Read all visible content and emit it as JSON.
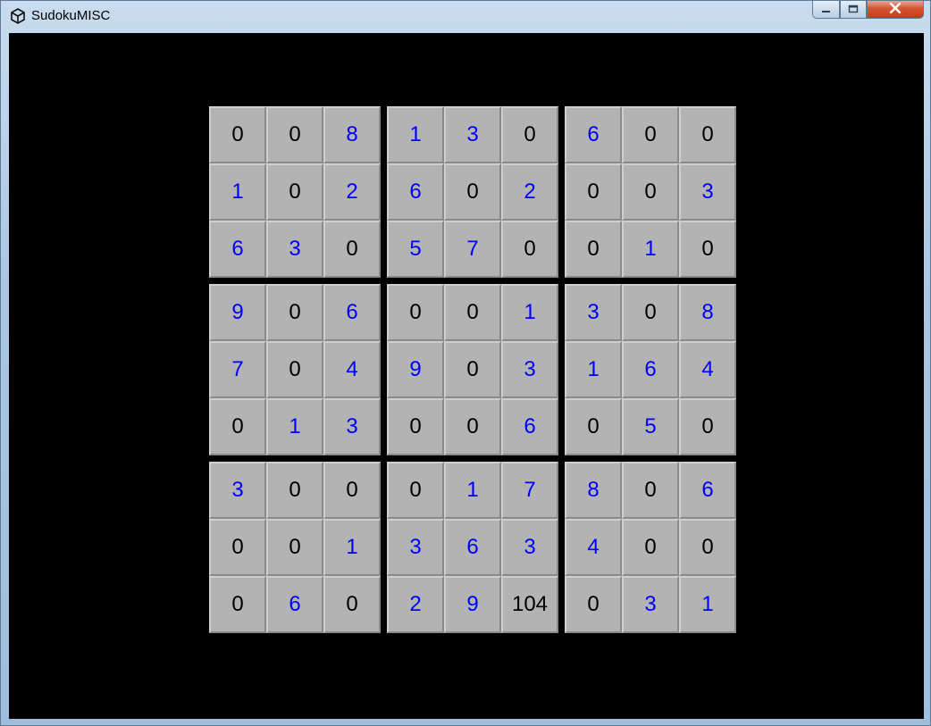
{
  "window": {
    "title": "SudokuMISC"
  },
  "colors": {
    "given": "#0000ff",
    "editable": "#000000"
  },
  "board": {
    "rows": [
      [
        {
          "v": "0",
          "given": false
        },
        {
          "v": "0",
          "given": false
        },
        {
          "v": "8",
          "given": true
        },
        {
          "v": "1",
          "given": true
        },
        {
          "v": "3",
          "given": true
        },
        {
          "v": "0",
          "given": false
        },
        {
          "v": "6",
          "given": true
        },
        {
          "v": "0",
          "given": false
        },
        {
          "v": "0",
          "given": false
        }
      ],
      [
        {
          "v": "1",
          "given": true
        },
        {
          "v": "0",
          "given": false
        },
        {
          "v": "2",
          "given": true
        },
        {
          "v": "6",
          "given": true
        },
        {
          "v": "0",
          "given": false
        },
        {
          "v": "2",
          "given": true
        },
        {
          "v": "0",
          "given": false
        },
        {
          "v": "0",
          "given": false
        },
        {
          "v": "3",
          "given": true
        }
      ],
      [
        {
          "v": "6",
          "given": true
        },
        {
          "v": "3",
          "given": true
        },
        {
          "v": "0",
          "given": false
        },
        {
          "v": "5",
          "given": true
        },
        {
          "v": "7",
          "given": true
        },
        {
          "v": "0",
          "given": false
        },
        {
          "v": "0",
          "given": false
        },
        {
          "v": "1",
          "given": true
        },
        {
          "v": "0",
          "given": false
        }
      ],
      [
        {
          "v": "9",
          "given": true
        },
        {
          "v": "0",
          "given": false
        },
        {
          "v": "6",
          "given": true
        },
        {
          "v": "0",
          "given": false
        },
        {
          "v": "0",
          "given": false
        },
        {
          "v": "1",
          "given": true
        },
        {
          "v": "3",
          "given": true
        },
        {
          "v": "0",
          "given": false
        },
        {
          "v": "8",
          "given": true
        }
      ],
      [
        {
          "v": "7",
          "given": true
        },
        {
          "v": "0",
          "given": false
        },
        {
          "v": "4",
          "given": true
        },
        {
          "v": "9",
          "given": true
        },
        {
          "v": "0",
          "given": false
        },
        {
          "v": "3",
          "given": true
        },
        {
          "v": "1",
          "given": true
        },
        {
          "v": "6",
          "given": true
        },
        {
          "v": "4",
          "given": true
        }
      ],
      [
        {
          "v": "0",
          "given": false
        },
        {
          "v": "1",
          "given": true
        },
        {
          "v": "3",
          "given": true
        },
        {
          "v": "0",
          "given": false
        },
        {
          "v": "0",
          "given": false
        },
        {
          "v": "6",
          "given": true
        },
        {
          "v": "0",
          "given": false
        },
        {
          "v": "5",
          "given": true
        },
        {
          "v": "0",
          "given": false
        }
      ],
      [
        {
          "v": "3",
          "given": true
        },
        {
          "v": "0",
          "given": false
        },
        {
          "v": "0",
          "given": false
        },
        {
          "v": "0",
          "given": false
        },
        {
          "v": "1",
          "given": true
        },
        {
          "v": "7",
          "given": true
        },
        {
          "v": "8",
          "given": true
        },
        {
          "v": "0",
          "given": false
        },
        {
          "v": "6",
          "given": true
        }
      ],
      [
        {
          "v": "0",
          "given": false
        },
        {
          "v": "0",
          "given": false
        },
        {
          "v": "1",
          "given": true
        },
        {
          "v": "3",
          "given": true
        },
        {
          "v": "6",
          "given": true
        },
        {
          "v": "3",
          "given": true
        },
        {
          "v": "4",
          "given": true
        },
        {
          "v": "0",
          "given": false
        },
        {
          "v": "0",
          "given": false
        }
      ],
      [
        {
          "v": "0",
          "given": false
        },
        {
          "v": "6",
          "given": true
        },
        {
          "v": "0",
          "given": false
        },
        {
          "v": "2",
          "given": true
        },
        {
          "v": "9",
          "given": true
        },
        {
          "v": "104",
          "given": false
        },
        {
          "v": "0",
          "given": false
        },
        {
          "v": "3",
          "given": true
        },
        {
          "v": "1",
          "given": true
        }
      ]
    ]
  }
}
